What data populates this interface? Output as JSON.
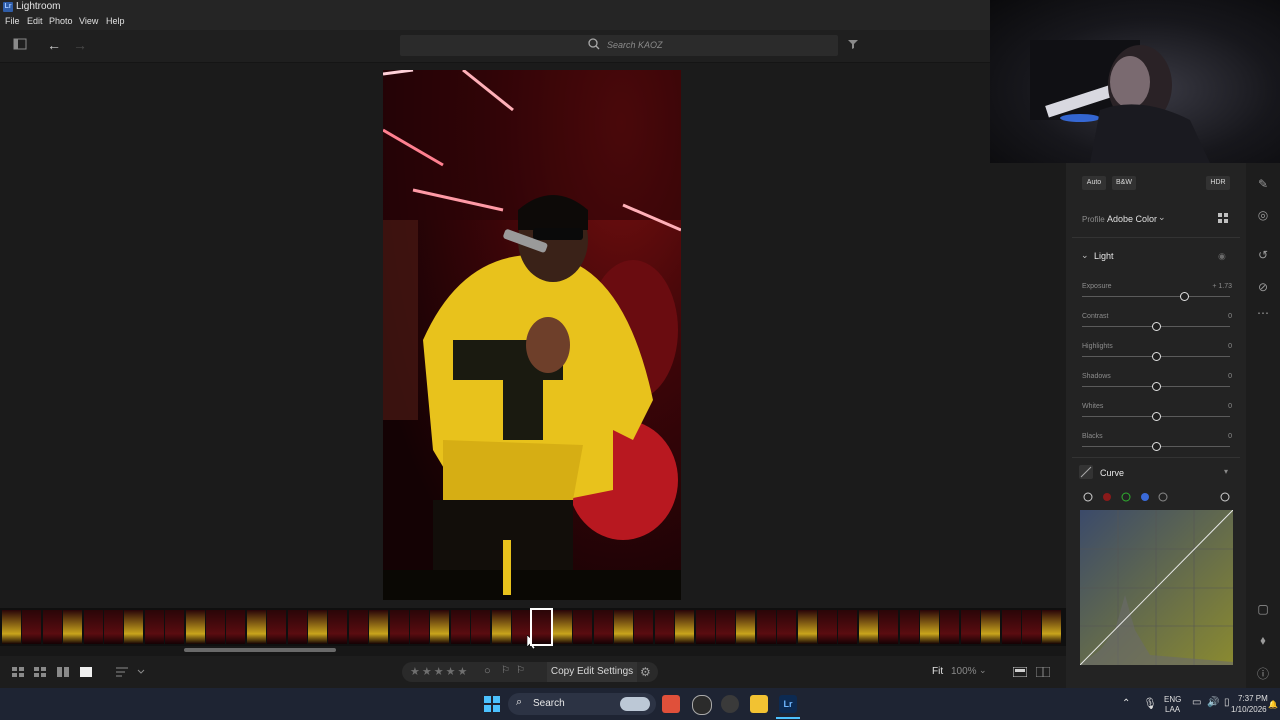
{
  "app": {
    "title": "Lightroom",
    "logo": "Lr"
  },
  "menu": [
    "File",
    "Edit",
    "Photo",
    "View",
    "Help"
  ],
  "toolbar": {
    "search_placeholder": "Search KAOZ"
  },
  "bottom": {
    "copy_edit": "Copy Edit Settings",
    "fit": "Fit",
    "zoom": "100%"
  },
  "edit_panel": {
    "auto": "Auto",
    "bw": "B&W",
    "hdr": "HDR",
    "profile_label": "Profile",
    "profile_value": "Adobe Color",
    "light_title": "Light",
    "sliders": [
      {
        "label": "Exposure",
        "value": "+ 1.73",
        "pos": 0.69
      },
      {
        "label": "Contrast",
        "value": "0",
        "pos": 0.5
      },
      {
        "label": "Highlights",
        "value": "0",
        "pos": 0.5
      },
      {
        "label": "Shadows",
        "value": "0",
        "pos": 0.5
      },
      {
        "label": "Whites",
        "value": "0",
        "pos": 0.5
      },
      {
        "label": "Blacks",
        "value": "0",
        "pos": 0.5
      }
    ],
    "curve_title": "Curve"
  },
  "taskbar": {
    "search": "Search",
    "lang": "ENG",
    "lang2": "LAA",
    "time": "7:37 PM",
    "date": "1/10/2026"
  },
  "colors": {
    "accent": "#2f5da8",
    "photo_yellow": "#e8c21c"
  }
}
